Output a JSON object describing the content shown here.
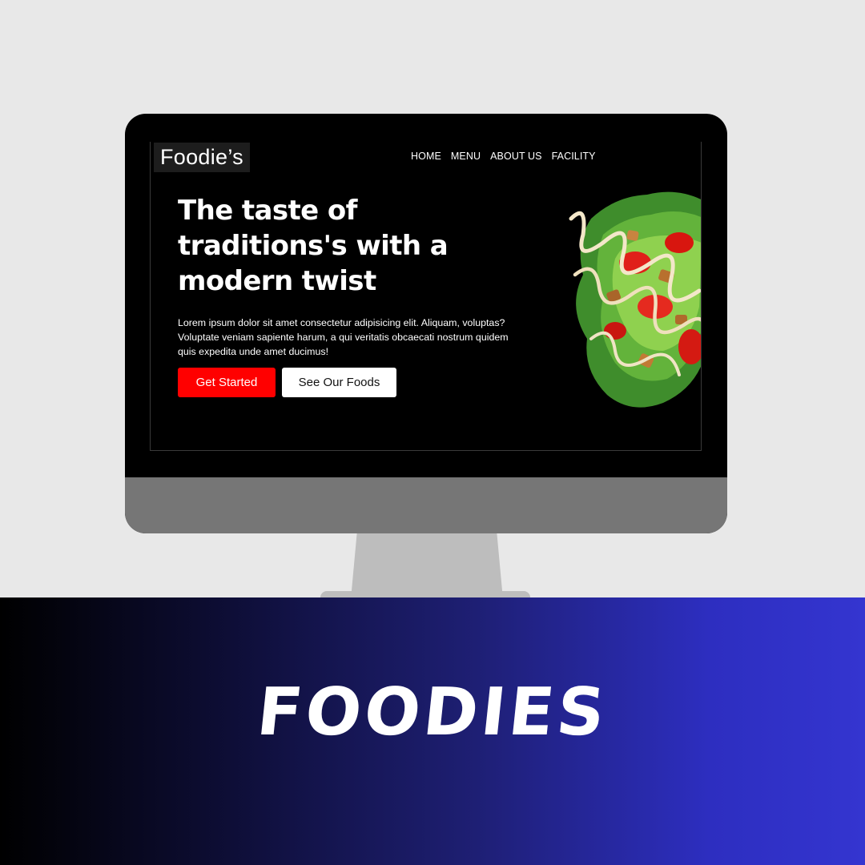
{
  "site": {
    "brand": "Foodie’s",
    "nav": [
      "HOME",
      "MENU",
      "ABOUT US",
      "FACILITY"
    ],
    "hero": {
      "headline": "The taste of traditions's with a modern twist",
      "lede": "Lorem ipsum dolor sit amet consectetur adipisicing elit. Aliquam, voluptas? Voluptate veniam sapiente harum, a qui veritatis obcaecati nostrum quidem quis expedita unde amet ducimus!",
      "primary_button": "Get Started",
      "secondary_button": "See Our Foods",
      "image": "salad-image"
    }
  },
  "banner": {
    "title": "FOODIES"
  },
  "colors": {
    "accent": "#ff0000",
    "screen_bg": "#000000",
    "page_bg": "#e8e8e8",
    "banner_gradient_end": "#3435d0"
  }
}
